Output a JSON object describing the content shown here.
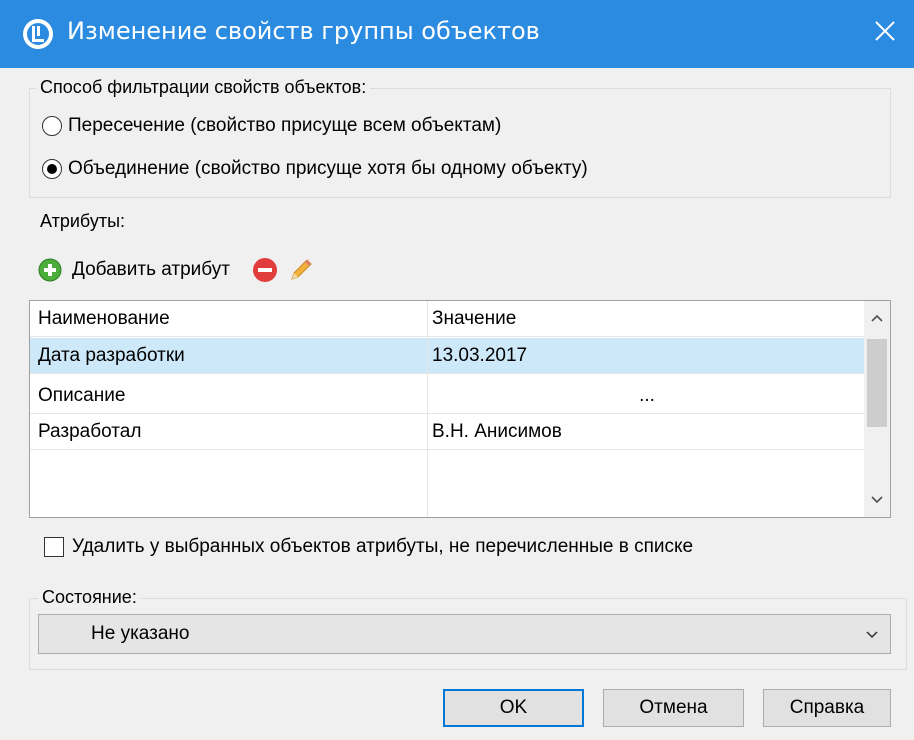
{
  "window": {
    "title": "Изменение свойств группы объектов"
  },
  "filter_group": {
    "label": "Способ фильтрации свойств объектов:",
    "options": [
      {
        "label": "Пересечение (свойство присуще всем объектам)",
        "checked": false
      },
      {
        "label": "Объединение (свойство присуще хотя бы одному объекту)",
        "checked": true
      }
    ]
  },
  "attributes_group": {
    "label": "Атрибуты:",
    "toolbar": {
      "add_label": "Добавить атрибут",
      "add_icon": "plus-circle-icon",
      "remove_icon": "minus-circle-icon",
      "edit_icon": "pencil-icon"
    },
    "table": {
      "columns": [
        "Наименование",
        "Значение"
      ],
      "rows": [
        {
          "name": "Дата разработки",
          "value": "13.03.2017",
          "selected": true
        },
        {
          "name": "Описание",
          "value": "...",
          "selected": false
        },
        {
          "name": "Разработал",
          "value": "В.Н. Анисимов",
          "selected": false
        }
      ]
    },
    "delete_checkbox": {
      "label": "Удалить у выбранных объектов атрибуты, не перечисленные в списке",
      "checked": false
    }
  },
  "state_group": {
    "label": "Состояние:",
    "selected": "Не указано"
  },
  "buttons": {
    "ok": "OK",
    "cancel": "Отмена",
    "help": "Справка"
  },
  "colors": {
    "titlebar": "#2b8be0",
    "selection": "#cde8f9",
    "dialog": "#f0f0f0",
    "default_button_border": "#0078d7"
  }
}
